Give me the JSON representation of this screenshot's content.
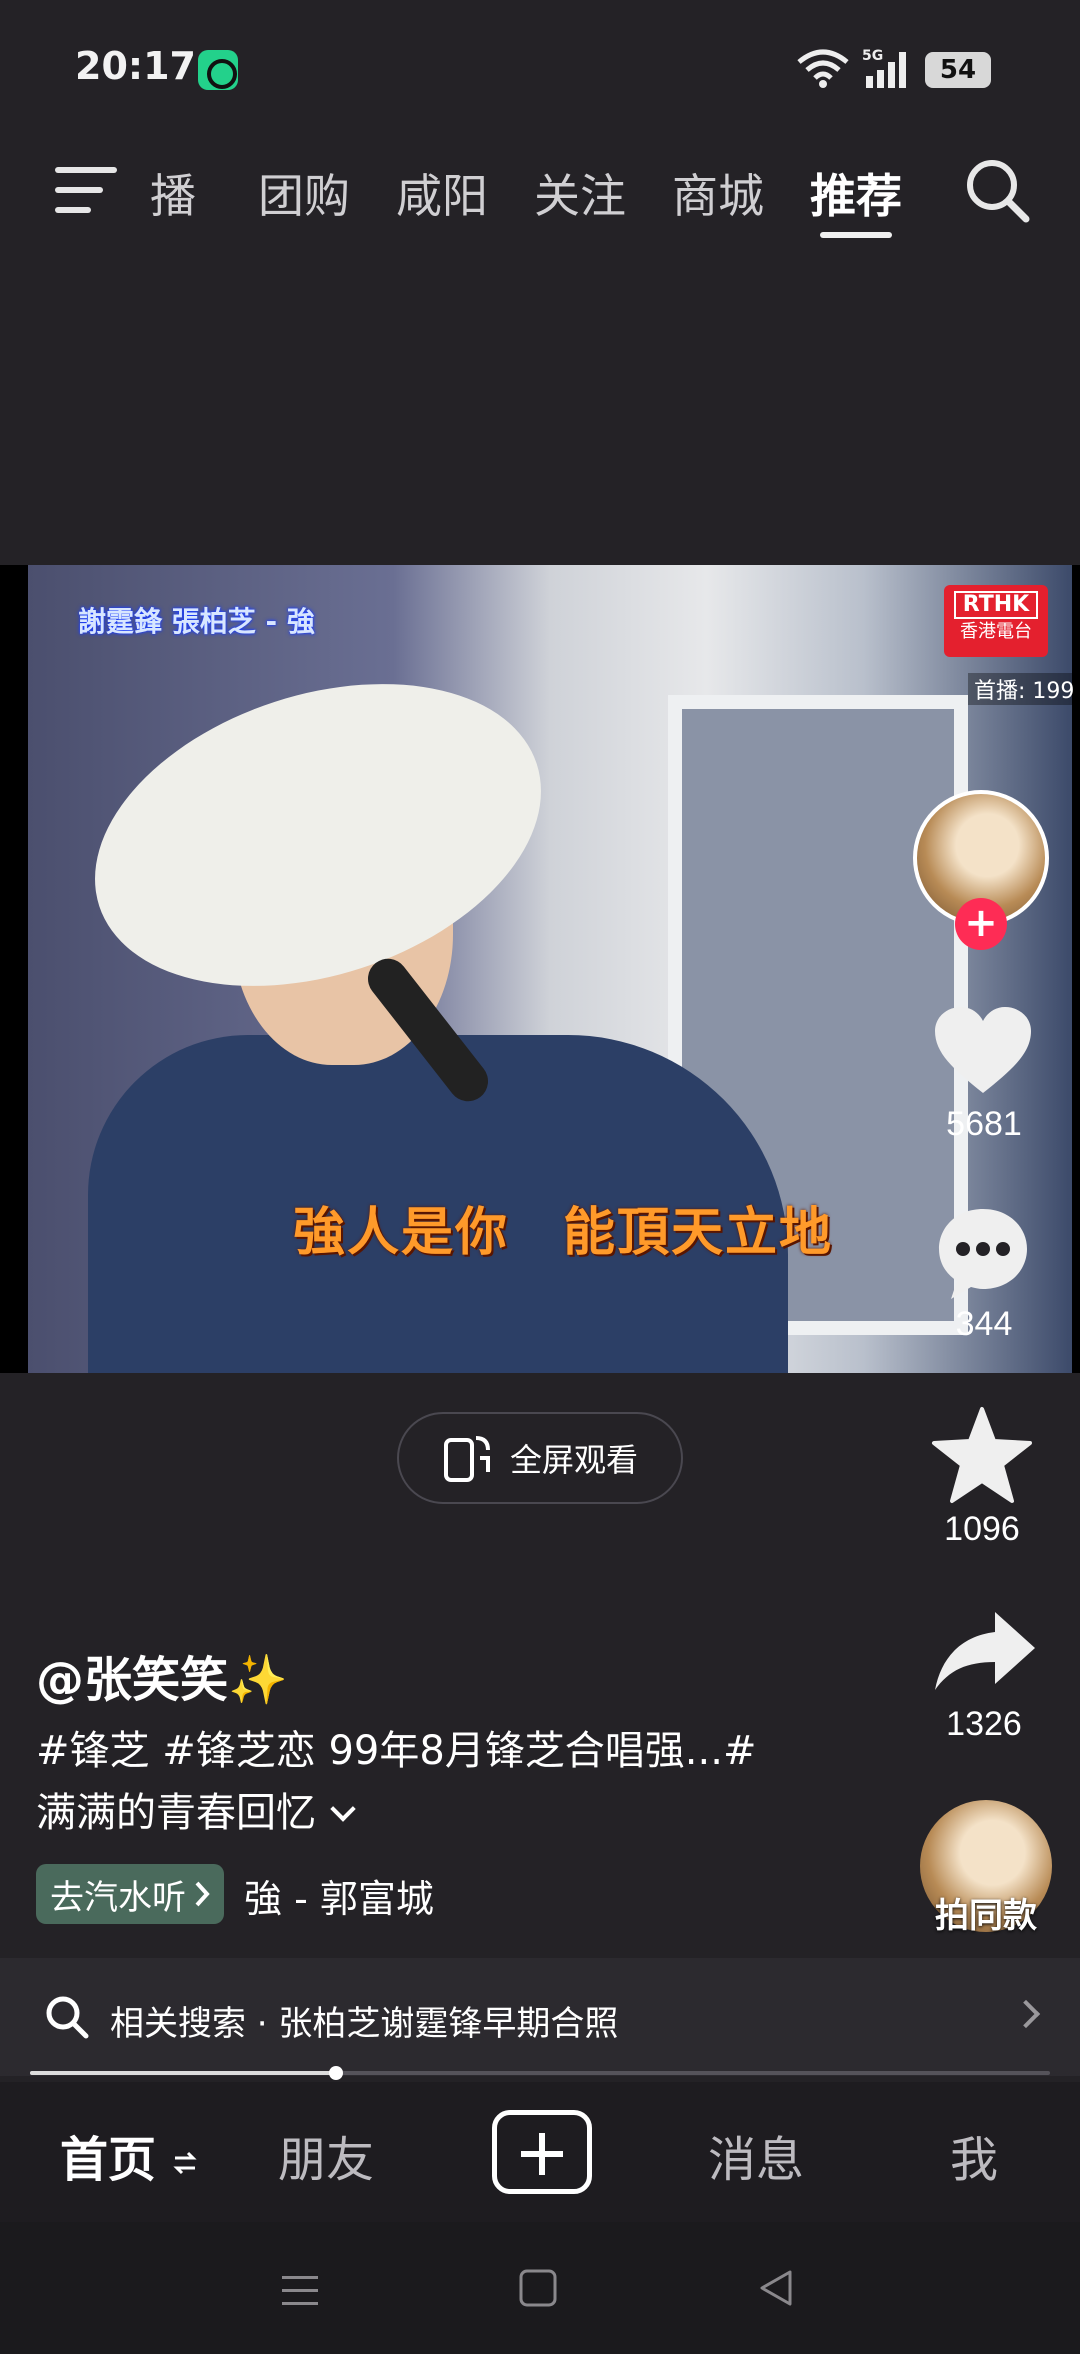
{
  "status_bar": {
    "time": "20:17",
    "network": "5G",
    "battery": "54"
  },
  "top_nav": {
    "tabs": [
      "播",
      "团购",
      "咸阳",
      "关注",
      "商城",
      "推荐"
    ],
    "active_tab": "推荐"
  },
  "video": {
    "caption_top": "謝霆鋒 張柏芝 - 強",
    "subtitle": "強人是你　能頂天立地",
    "logo_line1": "RTHK",
    "logo_line2": "香港電台",
    "tag": "首播: 199"
  },
  "actions": {
    "likes": "5681",
    "comments": "344",
    "favorites": "1096",
    "shares": "1326"
  },
  "fullscreen_label": "全屏观看",
  "post": {
    "author": "@张笑笑✨",
    "description_line1": "#锋芝 #锋芝恋 99年8月锋芝合唱强...#",
    "description_line2": "满满的青春回忆",
    "music_chip": "去汽水听",
    "music_title": "強 - 郭富城",
    "same_style_label": "拍同款"
  },
  "related_search": {
    "text": "相关搜索 · 张柏芝谢霆锋早期合照"
  },
  "playback": {
    "progress_percent": 30
  },
  "bottom_nav": {
    "home": "首页",
    "friends": "朋友",
    "messages": "消息",
    "me": "我"
  },
  "colors": {
    "accent": "#fe2c55",
    "background": "#242226",
    "music_chip": "#4a6a5c"
  }
}
